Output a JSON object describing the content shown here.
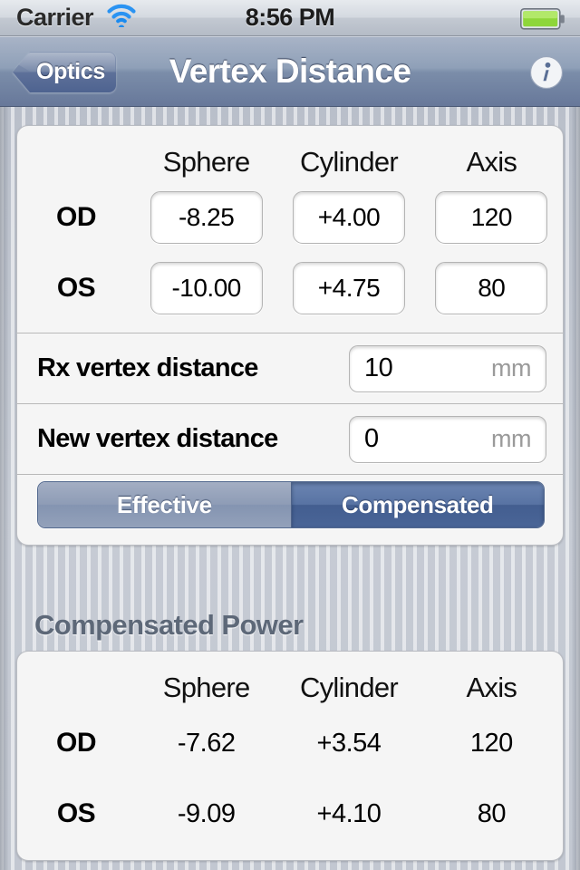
{
  "status_bar": {
    "carrier": "Carrier",
    "time": "8:56 PM",
    "wifi_icon": "wifi-icon",
    "battery_icon": "battery-full-icon"
  },
  "nav_bar": {
    "back_label": "Optics",
    "title": "Vertex Distance",
    "info_icon": "info-circle-icon"
  },
  "input_form": {
    "columns": [
      "Sphere",
      "Cylinder",
      "Axis"
    ],
    "rows": [
      {
        "eye": "OD",
        "sphere": "-8.25",
        "cylinder": "+4.00",
        "axis": "120"
      },
      {
        "eye": "OS",
        "sphere": "-10.00",
        "cylinder": "+4.75",
        "axis": "80"
      }
    ],
    "vertex_rows": [
      {
        "label": "Rx vertex distance",
        "value": "10",
        "unit": "mm"
      },
      {
        "label": "New vertex distance",
        "value": "0",
        "unit": "mm"
      }
    ],
    "segmented": {
      "options": [
        "Effective",
        "Compensated"
      ],
      "selected": "Compensated"
    }
  },
  "results": {
    "heading": "Compensated Power",
    "columns": [
      "Sphere",
      "Cylinder",
      "Axis"
    ],
    "rows": [
      {
        "eye": "OD",
        "sphere": "-7.62",
        "cylinder": "+3.54",
        "axis": "120"
      },
      {
        "eye": "OS",
        "sphere": "-9.09",
        "cylinder": "+4.10",
        "axis": "80"
      }
    ]
  },
  "colors": {
    "nav_bar": "#7b8da9",
    "selected_segment": "#435e90",
    "heading_text": "#5d6878",
    "battery_green": "#7ed321"
  }
}
